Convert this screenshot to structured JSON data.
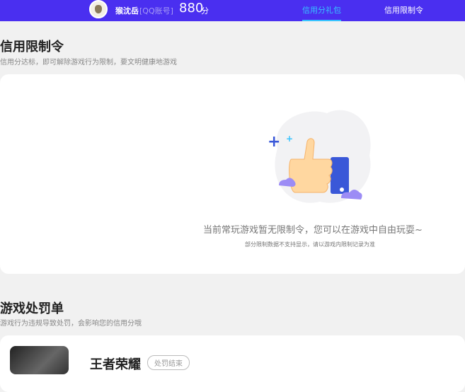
{
  "header": {
    "username": "猴沈岳",
    "account_type": "[QQ账号]",
    "score": "880",
    "score_unit": "分",
    "tabs": [
      {
        "label": "信用分礼包",
        "active": true
      },
      {
        "label": "信用限制令",
        "active": false
      }
    ],
    "bg_color": "#4a2ff0",
    "accent": "#37c3ff"
  },
  "restrictions": {
    "title": "信用限制令",
    "subtitle": "信用分达标，即可解除游戏行为限制，要文明健康地游戏",
    "empty_message": "当前常玩游戏暂无限制令，您可以在游戏中自由玩耍~",
    "note": "部分限制数据不支持显示，请以游戏内限制记录为准",
    "illustration": "thumbs-up-icon"
  },
  "penalties": {
    "title": "游戏处罚单",
    "subtitle": "游戏行为违规导致处罚，会影响您的信用分哦",
    "items": [
      {
        "game": "王者荣耀",
        "status": "处罚结束"
      }
    ]
  }
}
